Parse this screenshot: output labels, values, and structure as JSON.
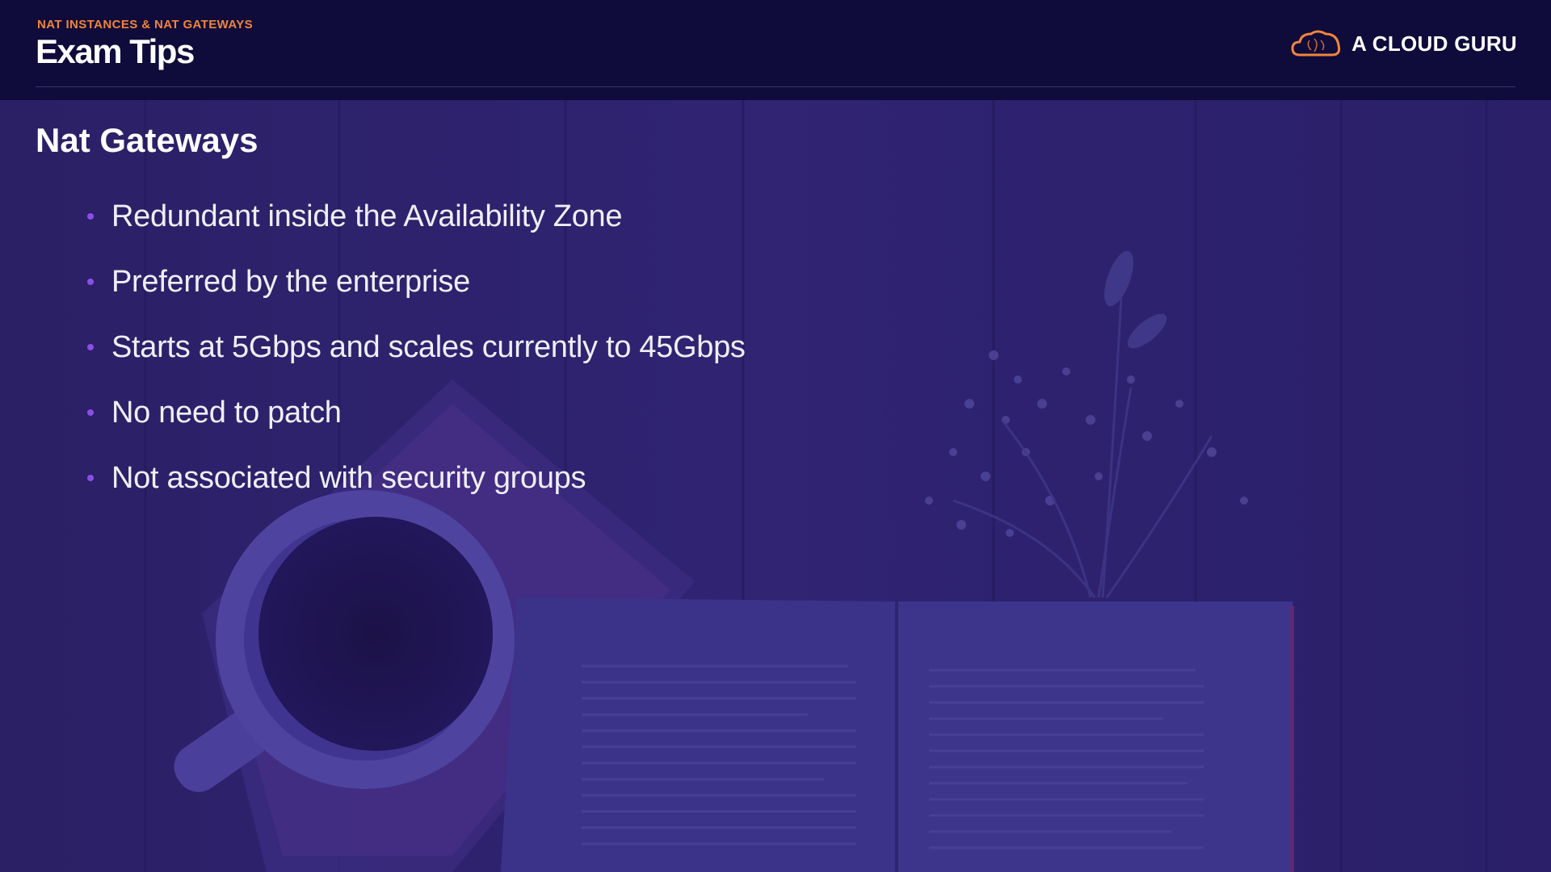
{
  "header": {
    "section_label": "NAT INSTANCES & NAT GATEWAYS",
    "title": "Exam Tips",
    "logo_text": "A CLOUD GURU",
    "logo_icon": "cloud-icon"
  },
  "content": {
    "title": "Nat Gateways",
    "bullets": [
      "Redundant inside the Availability Zone",
      "Preferred by the enterprise",
      "Starts at 5Gbps and scales currently to 45Gbps",
      "No need to patch",
      "Not associated with security groups"
    ]
  },
  "colors": {
    "header_bg": "#0f0b3a",
    "accent_orange": "#f2853a",
    "bullet_purple": "#8a4fe6",
    "overlay": "#2a1f6b"
  }
}
